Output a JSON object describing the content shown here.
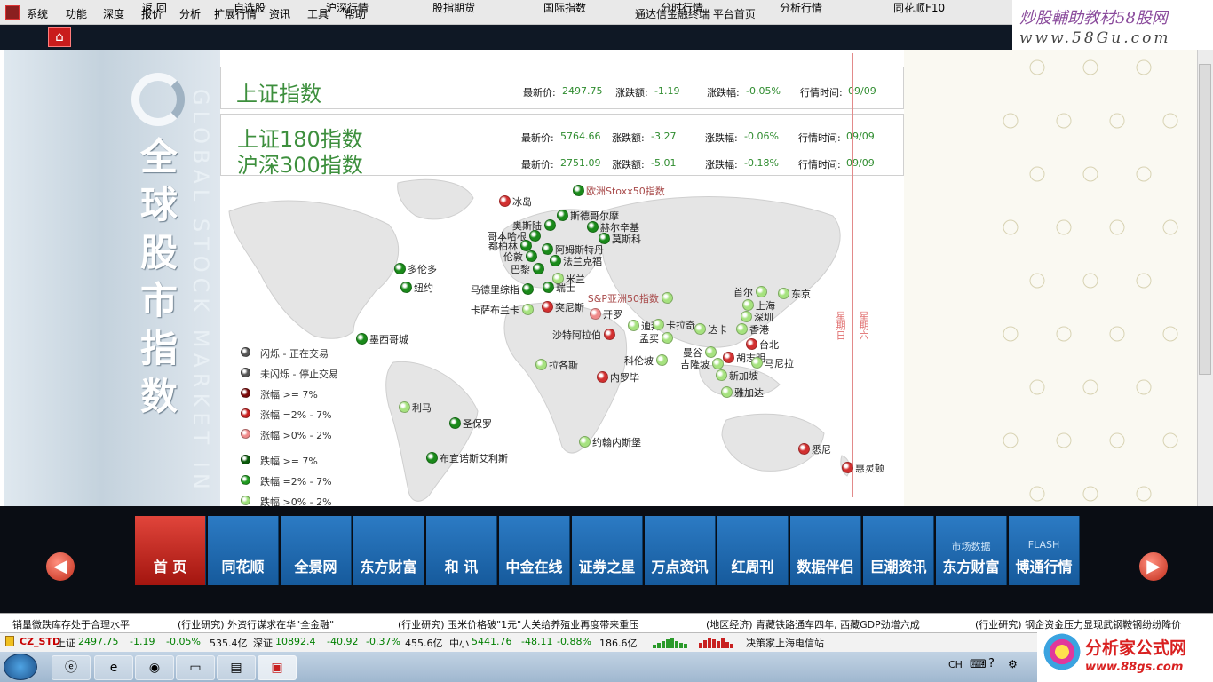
{
  "menu": {
    "items": [
      "系统",
      "功能",
      "深度",
      "报价",
      "分析",
      "扩展行情",
      "资讯",
      "工具",
      "帮助"
    ]
  },
  "window_title": "通达信金融终端  平台首页",
  "watermark_top": {
    "line1": "炒股輔助教材58股网",
    "line2": "www.58Gu.com"
  },
  "toolbar": {
    "home_icon": "home-icon",
    "tabs": [
      "返  回",
      "自选股",
      "沪深行情",
      "股指期货",
      "国际指数",
      "分时行情",
      "分析行情",
      "同花顺F10"
    ]
  },
  "side_banner": {
    "title": "全球股市指数",
    "subtitle": "GLOBAL STOCK MARKET IN"
  },
  "indices": {
    "sh": {
      "name": "上证指数",
      "price_label": "最新价:",
      "price": "2497.75",
      "chg_label": "涨跌额:",
      "chg": "-1.19",
      "pct_label": "涨跌幅:",
      "pct": "-0.05%",
      "time_label": "行情时间:",
      "time": "09/09"
    },
    "sh180": {
      "name": "上证180指数",
      "price_label": "最新价:",
      "price": "5764.66",
      "chg_label": "涨跌额:",
      "chg": "-3.27",
      "pct_label": "涨跌幅:",
      "pct": "-0.06%",
      "time_label": "行情时间:",
      "time": "09/09"
    },
    "hs300": {
      "name": "沪深300指数",
      "price_label": "最新价:",
      "price": "2751.09",
      "chg_label": "涨跌额:",
      "chg": "-5.01",
      "pct_label": "涨跌幅:",
      "pct": "-0.18%",
      "time_label": "行情时间:",
      "time": "09/09"
    }
  },
  "map": {
    "dateline_labels": [
      "星期日",
      "星期六"
    ],
    "cities": [
      {
        "name": "冰岛",
        "status": "up-mid"
      },
      {
        "name": "欧洲Stoxx50指数",
        "status": "down-big",
        "highlight": true
      },
      {
        "name": "斯德哥尔摩",
        "status": "down-big"
      },
      {
        "name": "奥斯陆",
        "status": "down-big"
      },
      {
        "name": "赫尔辛基",
        "status": "down-big"
      },
      {
        "name": "哥本哈根",
        "status": "down-big"
      },
      {
        "name": "莫斯科",
        "status": "down-big"
      },
      {
        "name": "都柏林",
        "status": "down-big"
      },
      {
        "name": "阿姆斯特丹",
        "status": "down-big"
      },
      {
        "name": "伦敦",
        "status": "down-big"
      },
      {
        "name": "法兰克福",
        "status": "down-big"
      },
      {
        "name": "巴黎",
        "status": "down-big"
      },
      {
        "name": "米兰",
        "status": "down-small"
      },
      {
        "name": "瑞士",
        "status": "down-big"
      },
      {
        "name": "马德里综指",
        "status": "down-big"
      },
      {
        "name": "多伦多",
        "status": "down-big"
      },
      {
        "name": "纽约",
        "status": "down-big"
      },
      {
        "name": "墨西哥城",
        "status": "down-big"
      },
      {
        "name": "卡萨布兰卡",
        "status": "down-small"
      },
      {
        "name": "突尼斯",
        "status": "up-mid"
      },
      {
        "name": "开罗",
        "status": "up-small"
      },
      {
        "name": "迪拜",
        "status": "down-small"
      },
      {
        "name": "沙特阿拉伯",
        "status": "up-mid"
      },
      {
        "name": "S&P亚洲50指数",
        "status": "down-small",
        "highlight": true
      },
      {
        "name": "卡拉奇",
        "status": "down-small"
      },
      {
        "name": "孟买",
        "status": "down-small"
      },
      {
        "name": "达卡",
        "status": "down-small"
      },
      {
        "name": "科伦坡",
        "status": "down-small"
      },
      {
        "name": "曼谷",
        "status": "down-small"
      },
      {
        "name": "吉隆坡",
        "status": "down-small"
      },
      {
        "name": "胡志明",
        "status": "up-mid"
      },
      {
        "name": "新加坡",
        "status": "down-small"
      },
      {
        "name": "雅加达",
        "status": "down-small"
      },
      {
        "name": "马尼拉",
        "status": "down-small"
      },
      {
        "name": "台北",
        "status": "up-mid"
      },
      {
        "name": "香港",
        "status": "down-small"
      },
      {
        "name": "深圳",
        "status": "down-small"
      },
      {
        "name": "上海",
        "status": "down-small"
      },
      {
        "name": "首尔",
        "status": "down-small"
      },
      {
        "name": "东京",
        "status": "down-small"
      },
      {
        "name": "拉各斯",
        "status": "down-small"
      },
      {
        "name": "内罗毕",
        "status": "up-mid"
      },
      {
        "name": "约翰内斯堡",
        "status": "down-small"
      },
      {
        "name": "利马",
        "status": "down-small"
      },
      {
        "name": "圣保罗",
        "status": "down-big"
      },
      {
        "name": "布宜诺斯艾利斯",
        "status": "down-big"
      },
      {
        "name": "悉尼",
        "status": "up-mid"
      },
      {
        "name": "惠灵顿",
        "status": "up-mid"
      }
    ]
  },
  "legend": [
    {
      "label": "闪烁 - 正在交易",
      "color": "#555555"
    },
    {
      "label": "未闪烁 - 停止交易",
      "color": "#555555"
    },
    {
      "label": "涨幅 >= 7%",
      "color": "#7a0a0a"
    },
    {
      "label": "涨幅 =2% - 7%",
      "color": "#c82020"
    },
    {
      "label": "涨幅 >0% - 2%",
      "color": "#f08a8a"
    },
    {
      "label": "跌幅 >= 7%",
      "color": "#0a5a0a"
    },
    {
      "label": "跌幅 =2% - 7%",
      "color": "#1f9a1f"
    },
    {
      "label": "跌幅 >0% - 2%",
      "color": "#9ee07a"
    }
  ],
  "bottom_nav": [
    {
      "label": "首  页",
      "sub": ""
    },
    {
      "label": "同花顺",
      "sub": ""
    },
    {
      "label": "全景网",
      "sub": ""
    },
    {
      "label": "东方财富",
      "sub": ""
    },
    {
      "label": "和  讯",
      "sub": ""
    },
    {
      "label": "中金在线",
      "sub": ""
    },
    {
      "label": "证券之星",
      "sub": ""
    },
    {
      "label": "万点资讯",
      "sub": ""
    },
    {
      "label": "红周刊",
      "sub": ""
    },
    {
      "label": "数据伴侣",
      "sub": ""
    },
    {
      "label": "巨潮资讯",
      "sub": ""
    },
    {
      "label": "东方财富",
      "sub": "市场数据"
    },
    {
      "label": "博通行情",
      "sub": "FLASH"
    }
  ],
  "ticker": [
    "销量微跌库存处于合理水平",
    "(行业研究) 外资行谋求在华\"全金融\"",
    "(行业研究) 玉米价格破\"1元\"大关给养殖业再度带来重压",
    "(地区经济) 青藏铁路通车四年, 西藏GDP劲增六成",
    "(行业研究) 钢企资金压力显现武钢鞍钢纷纷降价"
  ],
  "indexbar": {
    "tag": "CZ_STD",
    "sh": {
      "name": "上证",
      "value": "2497.75",
      "chg": "-1.19",
      "pct": "-0.05%",
      "amount": "535.4亿"
    },
    "sz": {
      "name": "深证",
      "value": "10892.4",
      "chg": "-40.92",
      "pct": "-0.37%",
      "amount": "455.6亿"
    },
    "zx": {
      "name": "中小",
      "value": "5441.76",
      "chg": "-48.11",
      "pct": "-0.88%",
      "amount": "186.6亿"
    },
    "broker": "决策家上海电信站"
  },
  "taskbar": {
    "tray_text": "CH",
    "apps": [
      "windows-icon",
      "ie-icon",
      "chrome-icon",
      "folder-icon",
      "book-icon",
      "tdx-icon"
    ]
  },
  "watermark_bottom": {
    "line1": "分析家公式网",
    "line2": "www.88gs.com"
  }
}
